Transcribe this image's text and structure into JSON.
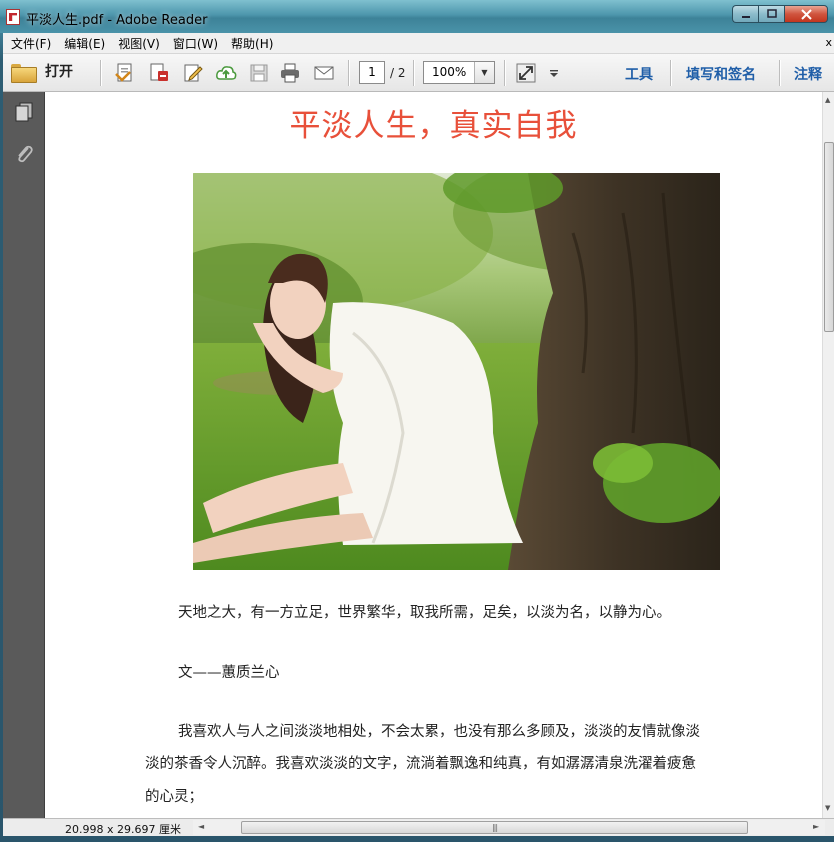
{
  "window": {
    "title": "平淡人生.pdf - Adobe Reader",
    "controls": {
      "minimize": "▭",
      "maximize": "□",
      "close": "✕"
    }
  },
  "menu": {
    "items": [
      {
        "label": "文件(F)"
      },
      {
        "label": "编辑(E)"
      },
      {
        "label": "视图(V)"
      },
      {
        "label": "窗口(W)"
      },
      {
        "label": "帮助(H)"
      }
    ],
    "close_glyph": "x"
  },
  "toolbar": {
    "open_label": "打开",
    "icons": [
      "create-pdf-icon",
      "convert-icon",
      "edit-icon",
      "upload-icon",
      "save-icon",
      "print-icon",
      "email-icon"
    ],
    "current_page": "1",
    "total_pages": "/ 2",
    "zoom": "100%",
    "links": {
      "tools": "工具",
      "fill_sign": "填写和签名",
      "comment": "注释"
    }
  },
  "document": {
    "title": "平淡人生，真实自我",
    "title_color": "#e8503a",
    "photo_description_icon": "photo-girl-under-tree",
    "paragraphs": [
      "天地之大，有一方立足，世界繁华，取我所需，足矣，以淡为名，以静为心。",
      "文——蕙质兰心",
      "我喜欢人与人之间淡淡地相处，不会太累，也没有那么多顾及，淡淡的友情就像淡",
      "淡的茶香令人沉醉。我喜欢淡淡的文字，流淌着飘逸和纯真，有如潺潺清泉洗濯着疲惫",
      "的心灵；"
    ]
  },
  "status": {
    "page_size": "20.998 x 29.697 厘米"
  }
}
